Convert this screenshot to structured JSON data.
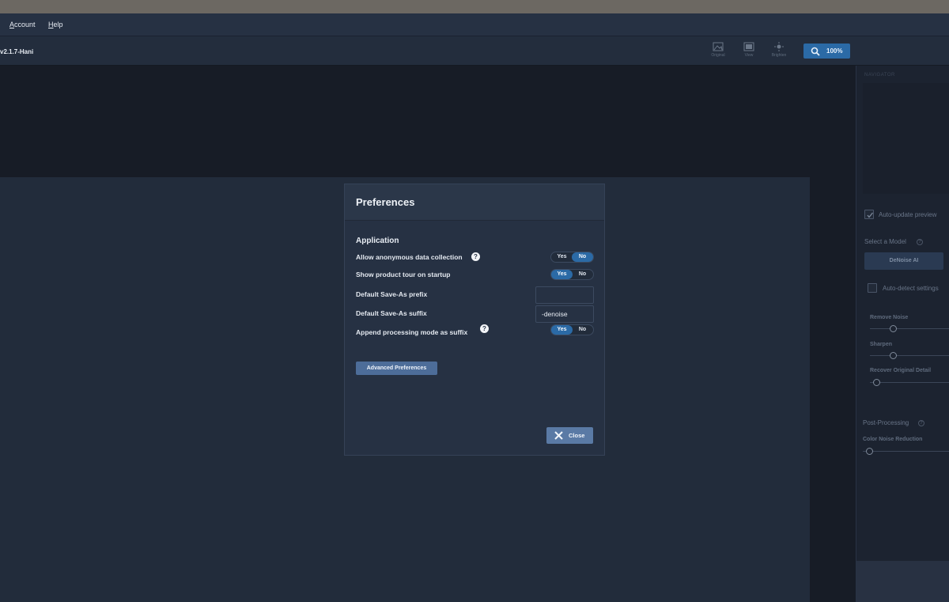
{
  "menu": {
    "account": {
      "first": "A",
      "rest": "ccount"
    },
    "help": {
      "first": "H",
      "rest": "elp"
    }
  },
  "toolbar": {
    "version": "v2.1.7-Hani",
    "tools": [
      {
        "label": "Original",
        "icon": "image-icon"
      },
      {
        "label": "View",
        "icon": "view-icon"
      },
      {
        "label": "Brighten",
        "icon": "brighten-icon"
      }
    ],
    "zoom": "100%"
  },
  "panel": {
    "navigator": "NAVIGATOR",
    "auto_update": "Auto-update preview",
    "select_model": "Select a Model",
    "model_button": "DeNoise AI",
    "auto_detect": "Auto-detect settings",
    "sliders": [
      "Remove Noise",
      "Sharpen",
      "Recover Original Detail"
    ],
    "post_processing": "Post-Processing",
    "color_noise": "Color Noise Reduction"
  },
  "dialog": {
    "title": "Preferences",
    "section": "Application",
    "prefs": {
      "anonymous_data": {
        "label": "Allow anonymous data collection",
        "yes": "Yes",
        "no": "No",
        "selected": "No"
      },
      "product_tour": {
        "label": "Show product tour on startup",
        "yes": "Yes",
        "no": "No",
        "selected": "Yes"
      },
      "prefix": {
        "label": "Default Save-As prefix",
        "value": ""
      },
      "suffix": {
        "label": "Default Save-As suffix",
        "value": "-denoise"
      },
      "append_mode": {
        "label": "Append processing mode as suffix",
        "yes": "Yes",
        "no": "No",
        "selected": "Yes"
      }
    },
    "help_glyph": "?",
    "advanced_button": "Advanced Preferences",
    "close_button": "Close"
  },
  "colors": {
    "accent": "#2b6aa6",
    "dialog_bg": "#263143",
    "canvas_bg": "#222c3b"
  }
}
